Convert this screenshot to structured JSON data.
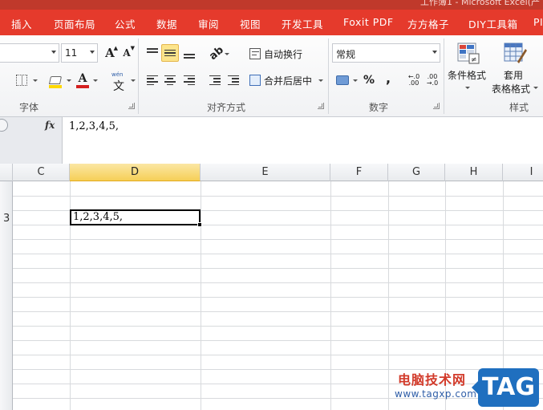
{
  "window": {
    "title_partial": "工作簿1 - Microsoft Excel(产"
  },
  "tabs": [
    "插入",
    "页面布局",
    "公式",
    "数据",
    "审阅",
    "视图",
    "开发工具",
    "Foxit PDF",
    "方方格子",
    "DIY工具箱",
    "PI"
  ],
  "ribbon": {
    "font": {
      "size": "11",
      "label": "字体",
      "grow_glyph": "A",
      "shrink_glyph": "A",
      "font_color_glyph": "A",
      "phonetic_glyph": "文",
      "phonetic_top": "wén"
    },
    "alignment": {
      "wrap_text": "自动换行",
      "merge_center": "合并后居中",
      "label": "对齐方式"
    },
    "number": {
      "format": "常规",
      "percent": "%",
      "comma": ",",
      "label": "数字"
    },
    "styles": {
      "conditional_format": "条件格式",
      "table_format_line1": "套用",
      "table_format_line2": "表格格式",
      "label": "样式"
    }
  },
  "formula_bar": {
    "fx": "fx",
    "value": "1,2,3,4,5,"
  },
  "grid": {
    "columns": [
      "C",
      "D",
      "E",
      "F",
      "G",
      "H",
      "I"
    ],
    "selected_column": "D",
    "visible_row_number": "3",
    "active_cell_value": "1,2,3,4,5,"
  },
  "watermark": {
    "cn": "电脑技术网",
    "url": "www.tagxp.com",
    "tag": "TAG"
  },
  "colors": {
    "tab_bar": "#e53a2c",
    "selected_header": "#f6cf57",
    "accent_blue": "#1f6fbf",
    "font_color_red": "#d42020"
  }
}
